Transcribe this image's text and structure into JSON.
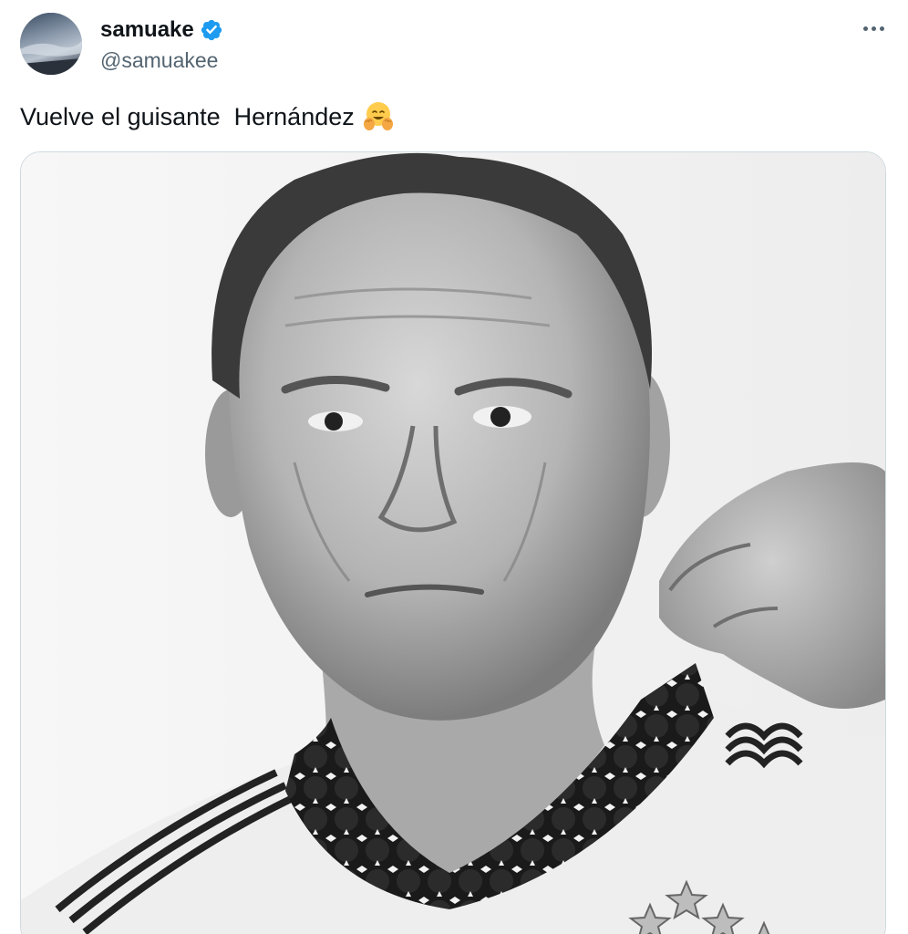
{
  "tweet": {
    "author": {
      "display_name": "samuake",
      "handle": "@samuakee",
      "verified": true,
      "verified_color": "#1d9bf0",
      "avatar_icon": "sky-avatar-icon"
    },
    "more_icon": "ellipsis-icon",
    "text": "Vuelve el guisante  Hernández",
    "emoji": "hugging-face-emoji",
    "media": {
      "type": "photo",
      "style": "black-and-white portrait"
    }
  }
}
